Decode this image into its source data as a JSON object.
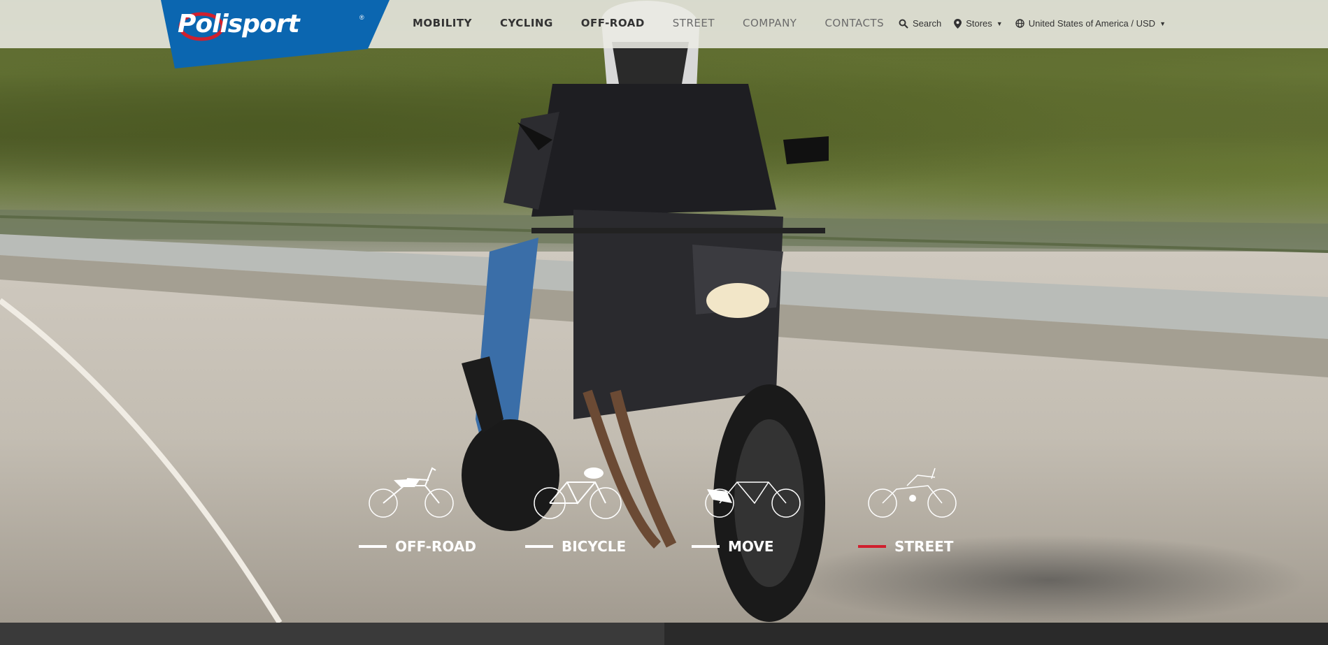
{
  "brand": {
    "name": "Polisport",
    "trademark": "®",
    "color": "#0b66b0"
  },
  "nav": {
    "items": [
      {
        "label": "MOBILITY",
        "dim": false
      },
      {
        "label": "CYCLING",
        "dim": false
      },
      {
        "label": "OFF-ROAD",
        "dim": false
      },
      {
        "label": "STREET",
        "dim": true
      },
      {
        "label": "COMPANY",
        "dim": true
      },
      {
        "label": "CONTACTS",
        "dim": true
      }
    ]
  },
  "utils": {
    "search": "Search",
    "stores": "Stores",
    "region": "United States of America / USD"
  },
  "categories": [
    {
      "label": "OFF-ROAD",
      "active": false,
      "icon": "dirtbike-icon"
    },
    {
      "label": "BICYCLE",
      "active": false,
      "icon": "bicycle-icon"
    },
    {
      "label": "MOVE",
      "active": false,
      "icon": "ebike-icon"
    },
    {
      "label": "STREET",
      "active": true,
      "icon": "street-motorcycle-icon"
    }
  ],
  "colors": {
    "accent": "#d0202e",
    "brand_blue": "#0b66b0"
  }
}
